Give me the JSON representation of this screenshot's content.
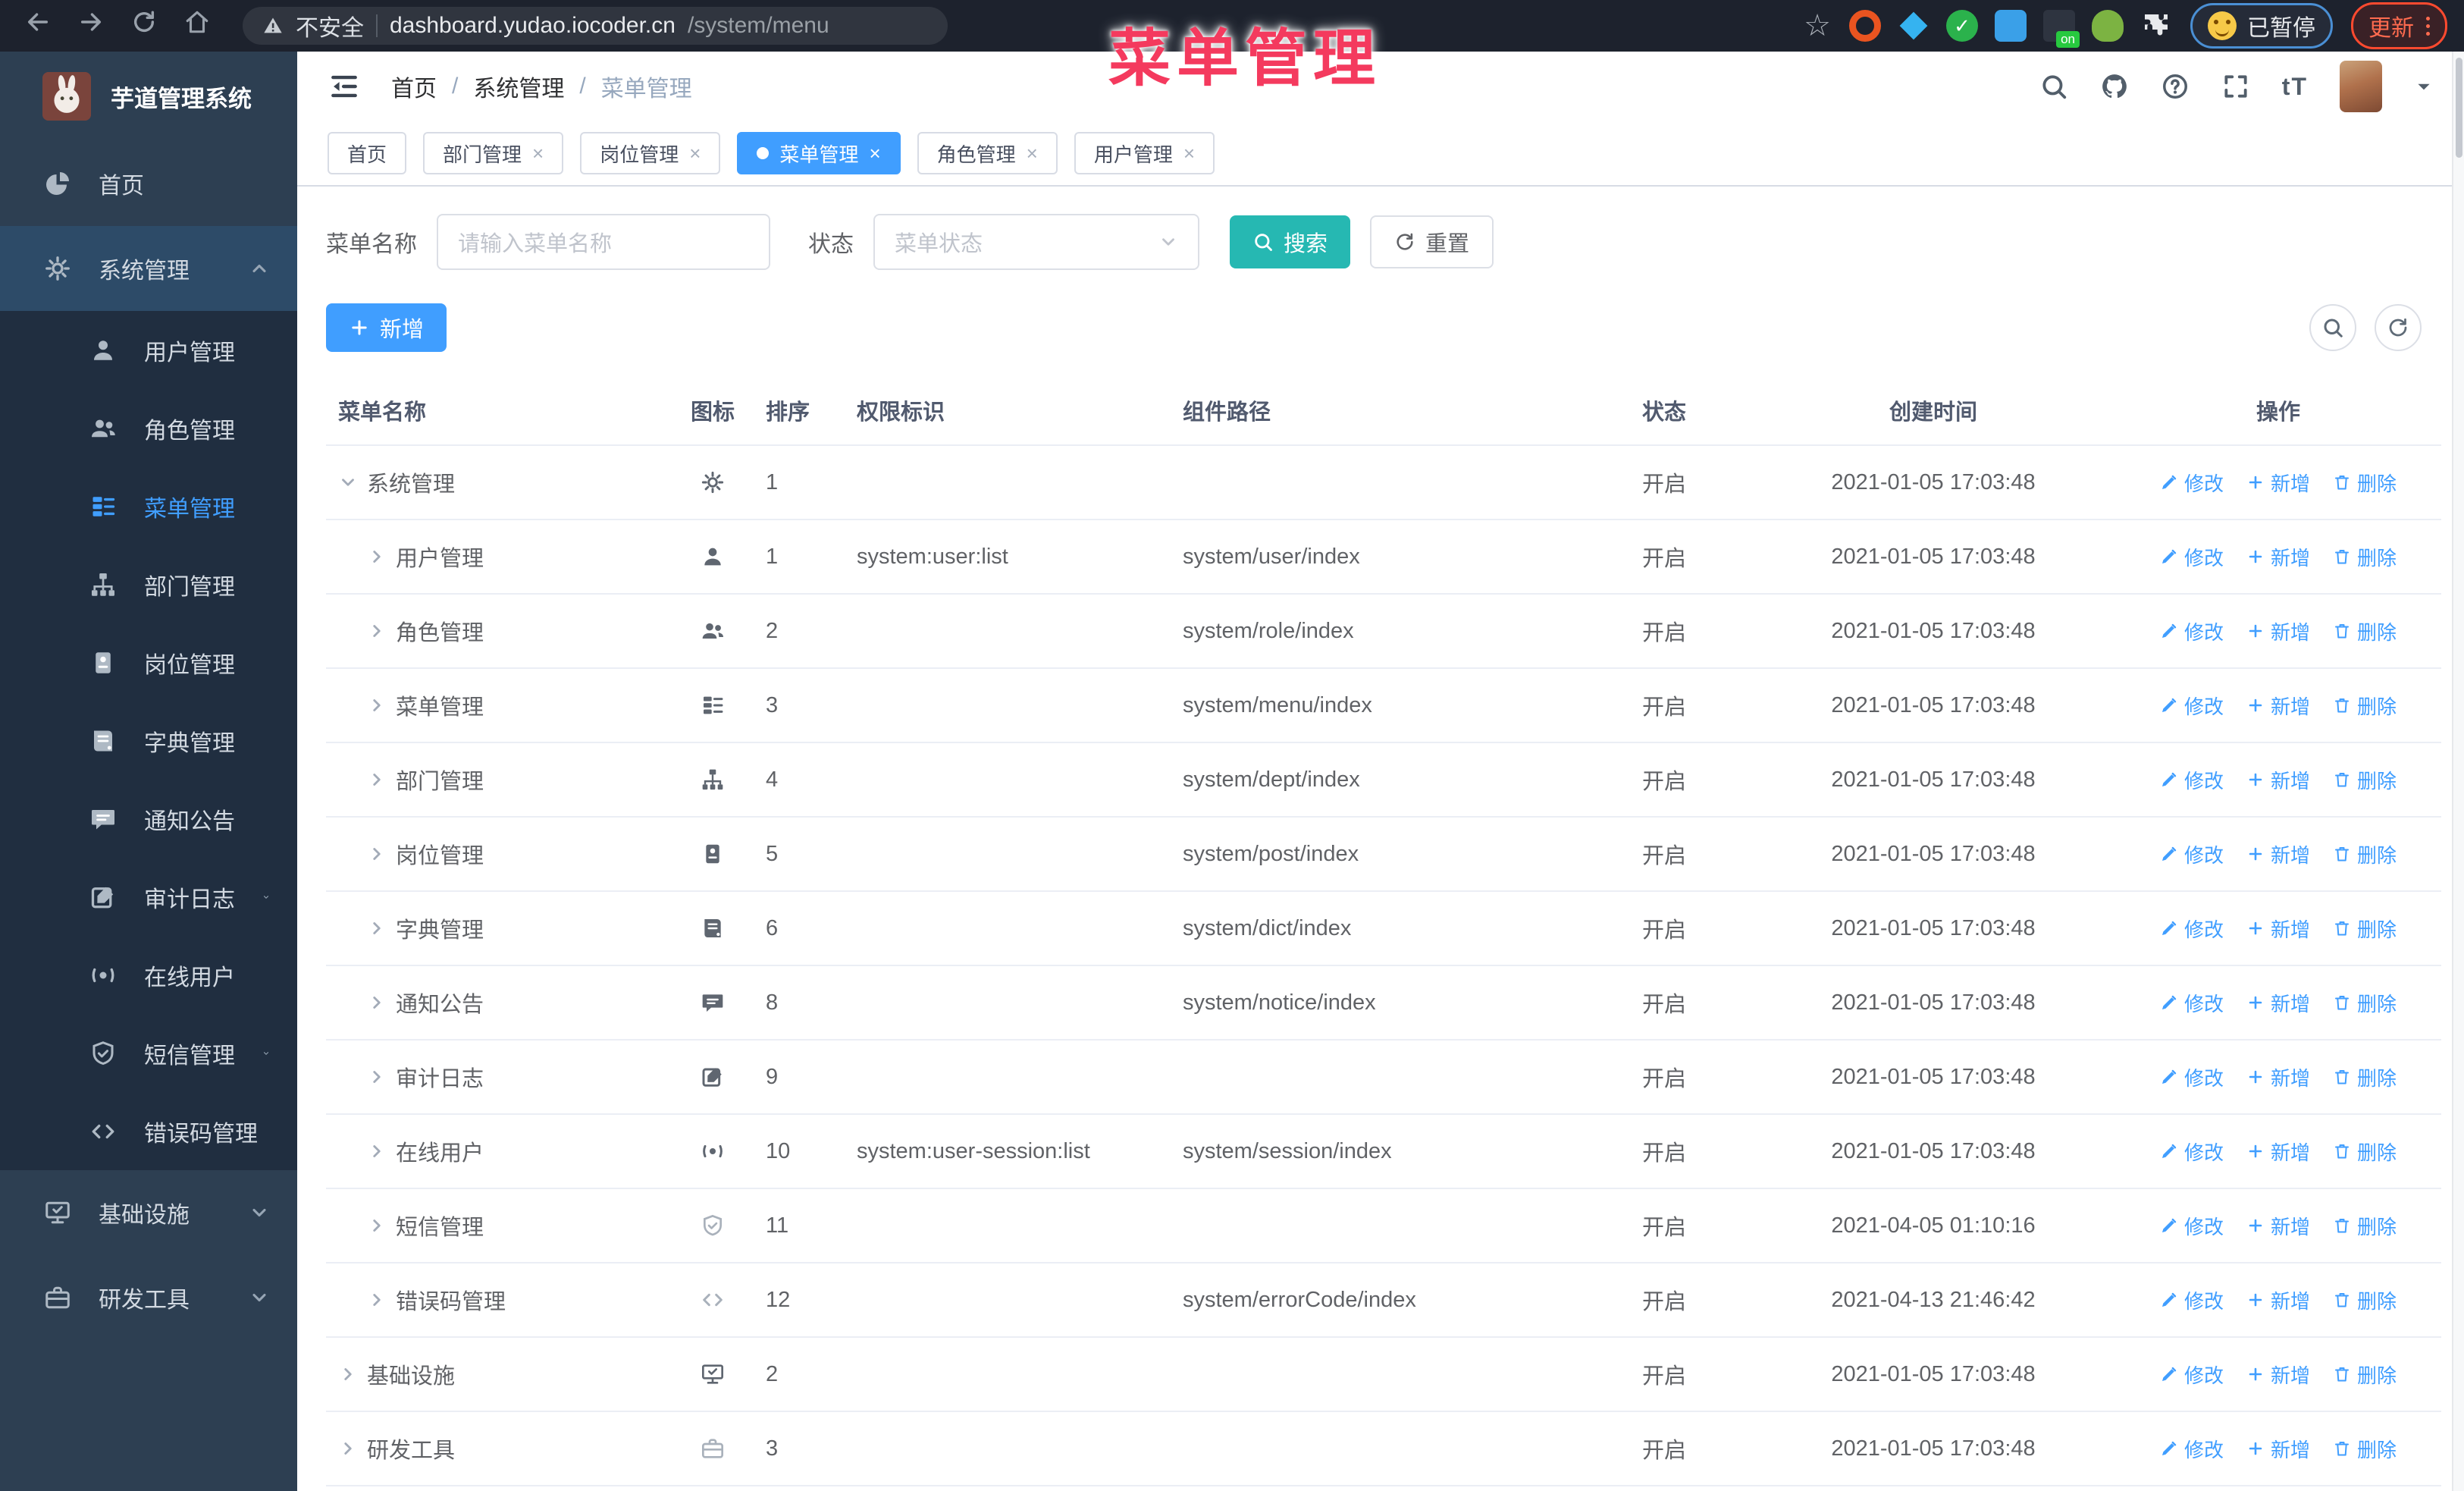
{
  "browser": {
    "insecure": "不安全",
    "url_host": "dashboard.yudao.iocoder.cn",
    "url_path": "/system/menu",
    "paused_badge": "已暂停",
    "update_label": "更新",
    "extensions": [
      {
        "name": "orange-ring-ext-icon",
        "style": "ring"
      },
      {
        "name": "blue-gem-ext-icon",
        "style": "gem"
      },
      {
        "name": "green-check-ext-icon",
        "style": "check",
        "glyph": "✓"
      },
      {
        "name": "blue-grid-ext-icon",
        "style": "grid"
      },
      {
        "name": "dark-grid-ext-icon",
        "style": "onbadge",
        "badge": "on"
      },
      {
        "name": "green-bug-ext-icon",
        "style": "bug"
      },
      {
        "name": "puzzle-ext-icon",
        "style": "puzzle"
      }
    ]
  },
  "overlay_title": "菜单管理",
  "sidebar": {
    "logo_title": "芋道管理系统",
    "items": [
      {
        "label": "首页",
        "icon": "dashboard-icon"
      },
      {
        "label": "系统管理",
        "icon": "gear-icon",
        "chevron": "up",
        "parent_active": true,
        "children": [
          {
            "label": "用户管理",
            "icon": "user-icon"
          },
          {
            "label": "角色管理",
            "icon": "users-icon"
          },
          {
            "label": "菜单管理",
            "icon": "menu-list-icon",
            "active": true
          },
          {
            "label": "部门管理",
            "icon": "org-tree-icon"
          },
          {
            "label": "岗位管理",
            "icon": "id-badge-icon"
          },
          {
            "label": "字典管理",
            "icon": "book-icon"
          },
          {
            "label": "通知公告",
            "icon": "notice-icon"
          },
          {
            "label": "审计日志",
            "icon": "edit-icon",
            "chevron": "down"
          },
          {
            "label": "在线用户",
            "icon": "online-icon"
          },
          {
            "label": "短信管理",
            "icon": "shield-icon",
            "chevron": "down"
          },
          {
            "label": "错误码管理",
            "icon": "code-icon"
          }
        ]
      },
      {
        "label": "基础设施",
        "icon": "monitor-icon",
        "chevron": "down"
      },
      {
        "label": "研发工具",
        "icon": "toolbox-icon",
        "chevron": "down"
      }
    ]
  },
  "header": {
    "breadcrumb": [
      "首页",
      "系统管理",
      "菜单管理"
    ]
  },
  "tabs": [
    {
      "label": "首页",
      "closable": false,
      "active": false
    },
    {
      "label": "部门管理",
      "closable": true,
      "active": false
    },
    {
      "label": "岗位管理",
      "closable": true,
      "active": false
    },
    {
      "label": "菜单管理",
      "closable": true,
      "active": true
    },
    {
      "label": "角色管理",
      "closable": true,
      "active": false
    },
    {
      "label": "用户管理",
      "closable": true,
      "active": false
    }
  ],
  "filters": {
    "name_label": "菜单名称",
    "name_placeholder": "请输入菜单名称",
    "status_label": "状态",
    "status_placeholder": "菜单状态",
    "search_label": "搜索",
    "reset_label": "重置"
  },
  "toolbar": {
    "add_label": "新增"
  },
  "table": {
    "columns": [
      "菜单名称",
      "图标",
      "排序",
      "权限标识",
      "组件路径",
      "状态",
      "创建时间",
      "操作"
    ],
    "actions": {
      "edit": "修改",
      "add": "新增",
      "delete": "删除"
    },
    "rows": [
      {
        "name": "系统管理",
        "level": 0,
        "expanded": true,
        "icon": "gear-icon",
        "muted": false,
        "sort": "1",
        "perm": "",
        "path": "",
        "status": "开启",
        "created": "2021-01-05 17:03:48"
      },
      {
        "name": "用户管理",
        "level": 1,
        "expanded": false,
        "icon": "user-icon",
        "muted": false,
        "sort": "1",
        "perm": "system:user:list",
        "path": "system/user/index",
        "status": "开启",
        "created": "2021-01-05 17:03:48"
      },
      {
        "name": "角色管理",
        "level": 1,
        "expanded": false,
        "icon": "users-icon",
        "muted": false,
        "sort": "2",
        "perm": "",
        "path": "system/role/index",
        "status": "开启",
        "created": "2021-01-05 17:03:48"
      },
      {
        "name": "菜单管理",
        "level": 1,
        "expanded": false,
        "icon": "menu-list-icon",
        "muted": false,
        "sort": "3",
        "perm": "",
        "path": "system/menu/index",
        "status": "开启",
        "created": "2021-01-05 17:03:48"
      },
      {
        "name": "部门管理",
        "level": 1,
        "expanded": false,
        "icon": "org-tree-icon",
        "muted": false,
        "sort": "4",
        "perm": "",
        "path": "system/dept/index",
        "status": "开启",
        "created": "2021-01-05 17:03:48"
      },
      {
        "name": "岗位管理",
        "level": 1,
        "expanded": false,
        "icon": "id-badge-icon",
        "muted": false,
        "sort": "5",
        "perm": "",
        "path": "system/post/index",
        "status": "开启",
        "created": "2021-01-05 17:03:48"
      },
      {
        "name": "字典管理",
        "level": 1,
        "expanded": false,
        "icon": "book-icon",
        "muted": false,
        "sort": "6",
        "perm": "",
        "path": "system/dict/index",
        "status": "开启",
        "created": "2021-01-05 17:03:48"
      },
      {
        "name": "通知公告",
        "level": 1,
        "expanded": false,
        "icon": "notice-icon",
        "muted": false,
        "sort": "8",
        "perm": "",
        "path": "system/notice/index",
        "status": "开启",
        "created": "2021-01-05 17:03:48"
      },
      {
        "name": "审计日志",
        "level": 1,
        "expanded": false,
        "icon": "edit-icon",
        "muted": false,
        "sort": "9",
        "perm": "",
        "path": "",
        "status": "开启",
        "created": "2021-01-05 17:03:48"
      },
      {
        "name": "在线用户",
        "level": 1,
        "expanded": false,
        "icon": "online-icon",
        "muted": false,
        "sort": "10",
        "perm": "system:user-session:list",
        "path": "system/session/index",
        "status": "开启",
        "created": "2021-01-05 17:03:48"
      },
      {
        "name": "短信管理",
        "level": 1,
        "expanded": false,
        "icon": "shield-icon",
        "muted": true,
        "sort": "11",
        "perm": "",
        "path": "",
        "status": "开启",
        "created": "2021-04-05 01:10:16"
      },
      {
        "name": "错误码管理",
        "level": 1,
        "expanded": false,
        "icon": "code-icon",
        "muted": true,
        "sort": "12",
        "perm": "",
        "path": "system/errorCode/index",
        "status": "开启",
        "created": "2021-04-13 21:46:42"
      },
      {
        "name": "基础设施",
        "level": 0,
        "expanded": false,
        "icon": "monitor-icon",
        "muted": false,
        "sort": "2",
        "perm": "",
        "path": "",
        "status": "开启",
        "created": "2021-01-05 17:03:48"
      },
      {
        "name": "研发工具",
        "level": 0,
        "expanded": false,
        "icon": "toolbox-icon",
        "muted": true,
        "sort": "3",
        "perm": "",
        "path": "",
        "status": "开启",
        "created": "2021-01-05 17:03:48"
      }
    ]
  },
  "colors": {
    "accent_blue": "#409eff",
    "search_teal": "#26b8b2",
    "overlay_red": "#f43a5e",
    "sidebar_bg": "#2d3f52",
    "submenu_bg": "#202e40"
  }
}
